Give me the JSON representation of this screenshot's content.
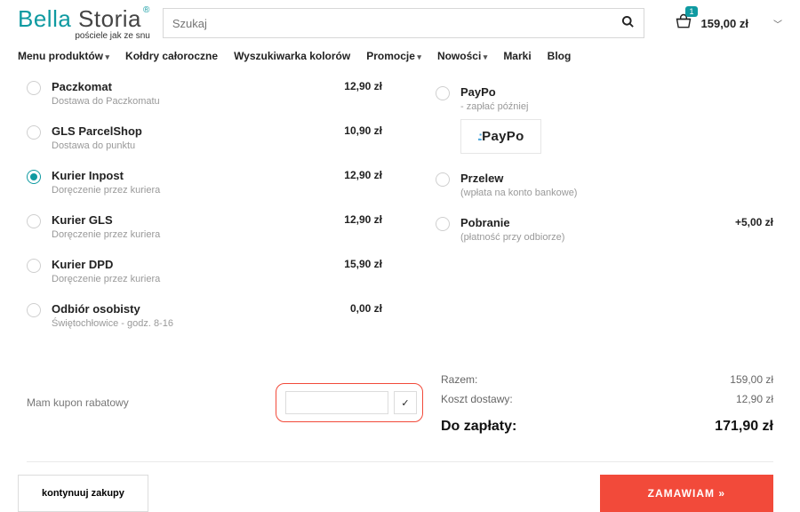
{
  "header": {
    "logo_part1": "Bella ",
    "logo_part2": "Storia",
    "logo_reg": "®",
    "tagline": "pościele jak ze snu",
    "search_placeholder": "Szukaj",
    "cart_count": "1",
    "cart_total": "159,00 zł"
  },
  "nav": {
    "menu": "Menu produktów",
    "duvets": "Kołdry całoroczne",
    "colors": "Wyszukiwarka kolorów",
    "promo": "Promocje",
    "news": "Nowości",
    "brands": "Marki",
    "blog": "Blog"
  },
  "shipping": [
    {
      "title": "Paczkomat",
      "sub": "Dostawa do Paczkomatu",
      "price": "12,90 zł",
      "selected": false
    },
    {
      "title": "GLS ParcelShop",
      "sub": "Dostawa do punktu",
      "price": "10,90 zł",
      "selected": false
    },
    {
      "title": "Kurier Inpost",
      "sub": "Doręczenie przez kuriera",
      "price": "12,90 zł",
      "selected": true
    },
    {
      "title": "Kurier GLS",
      "sub": "Doręczenie przez kuriera",
      "price": "12,90 zł",
      "selected": false
    },
    {
      "title": "Kurier DPD",
      "sub": "Doręczenie przez kuriera",
      "price": "15,90 zł",
      "selected": false
    },
    {
      "title": "Odbiór osobisty",
      "sub": "Świętochłowice - godz. 8-16",
      "price": "0,00 zł",
      "selected": false
    }
  ],
  "payment": [
    {
      "title": "PayPo",
      "sub": "- zapłać później",
      "price": "",
      "logo": true
    },
    {
      "title": "Przelew",
      "sub": "(wpłata na konto bankowe)",
      "price": ""
    },
    {
      "title": "Pobranie",
      "sub": "(płatność przy odbiorze)",
      "price": "+5,00 zł"
    }
  ],
  "paypo_logo": {
    "dots": ".:",
    "text": "PayPo"
  },
  "coupon": {
    "label": "Mam kupon rabatowy",
    "apply_icon": "✓"
  },
  "totals": {
    "subtotal_label": "Razem:",
    "subtotal_value": "159,00 zł",
    "shipping_label": "Koszt dostawy:",
    "shipping_value": "12,90 zł",
    "grand_label": "Do zapłaty:",
    "grand_value": "171,90 zł"
  },
  "buttons": {
    "continue": "kontynuuj zakupy",
    "order": "ZAMAWIAM »"
  }
}
